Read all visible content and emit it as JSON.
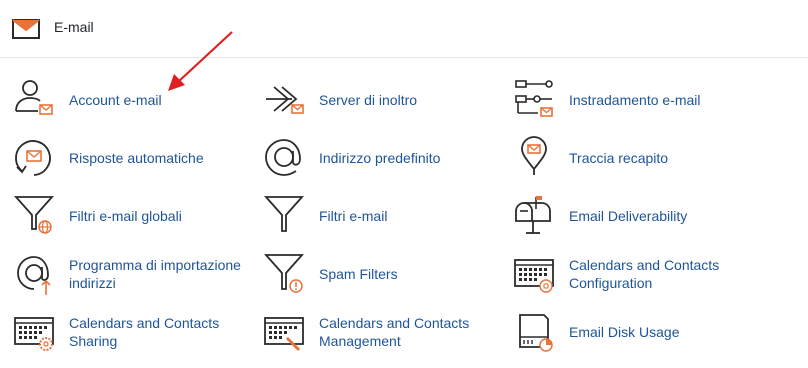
{
  "header": {
    "title": "E-mail",
    "icon": "envelope-icon"
  },
  "items": [
    {
      "label": "Account e-mail",
      "icon": "user-mail-icon"
    },
    {
      "label": "Server di inoltro",
      "icon": "forward-mail-icon"
    },
    {
      "label": "Instradamento e-mail",
      "icon": "routing-icon"
    },
    {
      "label": "Risposte automatiche",
      "icon": "autoresponder-icon"
    },
    {
      "label": "Indirizzo predefinito",
      "icon": "at-sign-icon"
    },
    {
      "label": "Traccia recapito",
      "icon": "location-pin-icon"
    },
    {
      "label": "Filtri e-mail globali",
      "icon": "global-filter-icon"
    },
    {
      "label": "Filtri e-mail",
      "icon": "filter-icon"
    },
    {
      "label": "Email Deliverability",
      "icon": "mailbox-icon"
    },
    {
      "label": "Programma di importazione indirizzi",
      "icon": "import-at-icon"
    },
    {
      "label": "Spam Filters",
      "icon": "spam-filter-icon"
    },
    {
      "label": "Calendars and Contacts Configuration",
      "icon": "calendar-at-icon"
    },
    {
      "label": "Calendars and Contacts Sharing",
      "icon": "calendar-gear-icon"
    },
    {
      "label": "Calendars and Contacts Management",
      "icon": "calendar-pencil-icon"
    },
    {
      "label": "Email Disk Usage",
      "icon": "disk-usage-icon"
    }
  ],
  "colors": {
    "accent": "#e8733a",
    "link": "#1f5598",
    "icon": "#2b2b2b",
    "arrow": "#e02020"
  }
}
